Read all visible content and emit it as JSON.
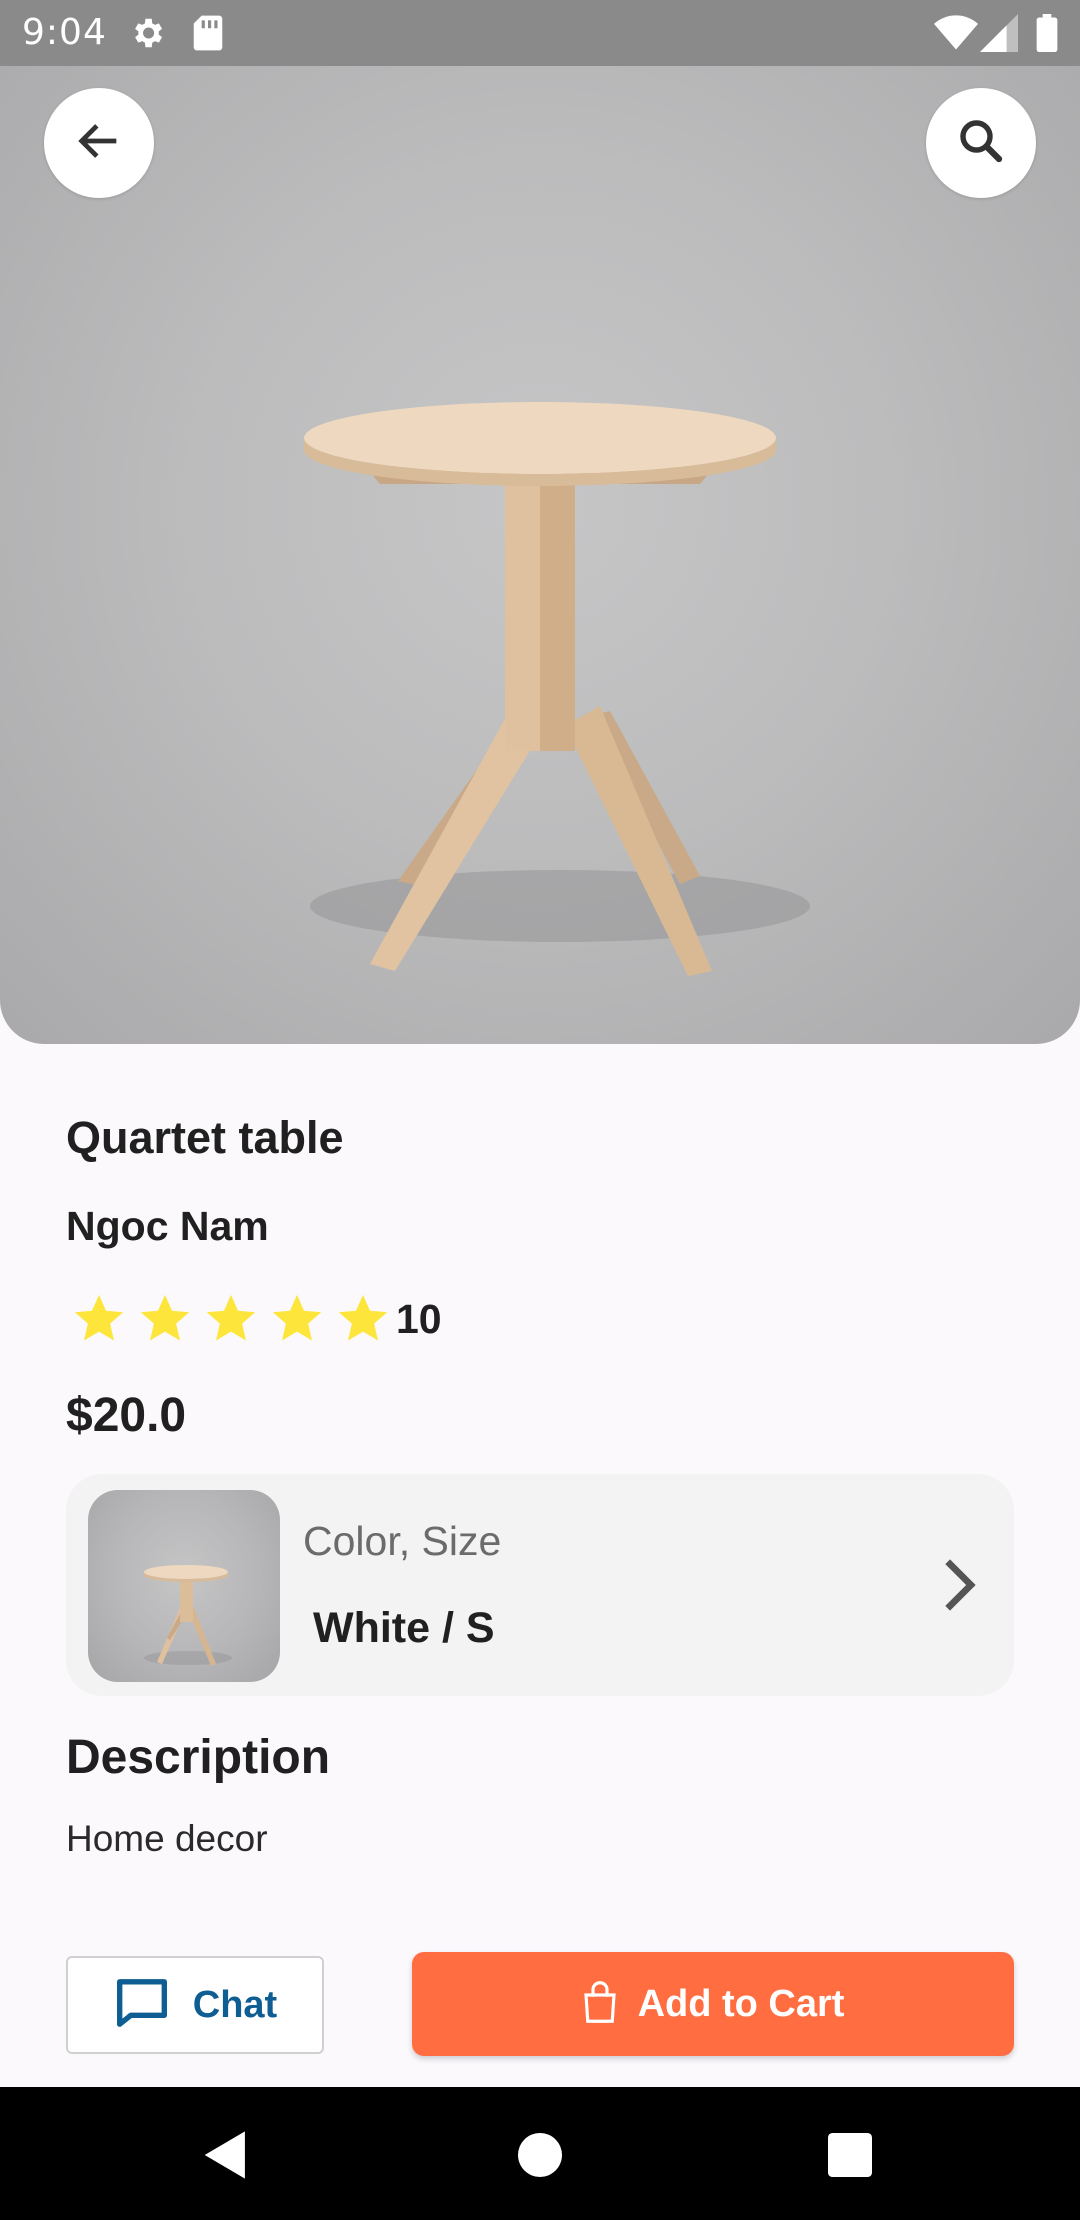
{
  "status_bar": {
    "time": "9:04",
    "icons": [
      "gear-icon",
      "sd-card-icon",
      "wifi-icon",
      "cell-signal-icon",
      "battery-icon"
    ]
  },
  "header": {
    "back_icon": "arrow-left-icon",
    "search_icon": "search-icon"
  },
  "product": {
    "title": "Quartet table",
    "seller": "Ngoc Nam",
    "rating": {
      "stars": 5,
      "max": 5,
      "count": "10"
    },
    "price": "$20.0"
  },
  "variant": {
    "label": "Color, Size",
    "value": "White / S"
  },
  "description": {
    "heading": "Description",
    "text": "Home decor"
  },
  "actions": {
    "chat_label": "Chat",
    "add_to_cart_label": "Add to Cart"
  },
  "colors": {
    "accent": "#ff6d40",
    "chat_blue": "#0e5d93",
    "star": "#fde53c"
  }
}
